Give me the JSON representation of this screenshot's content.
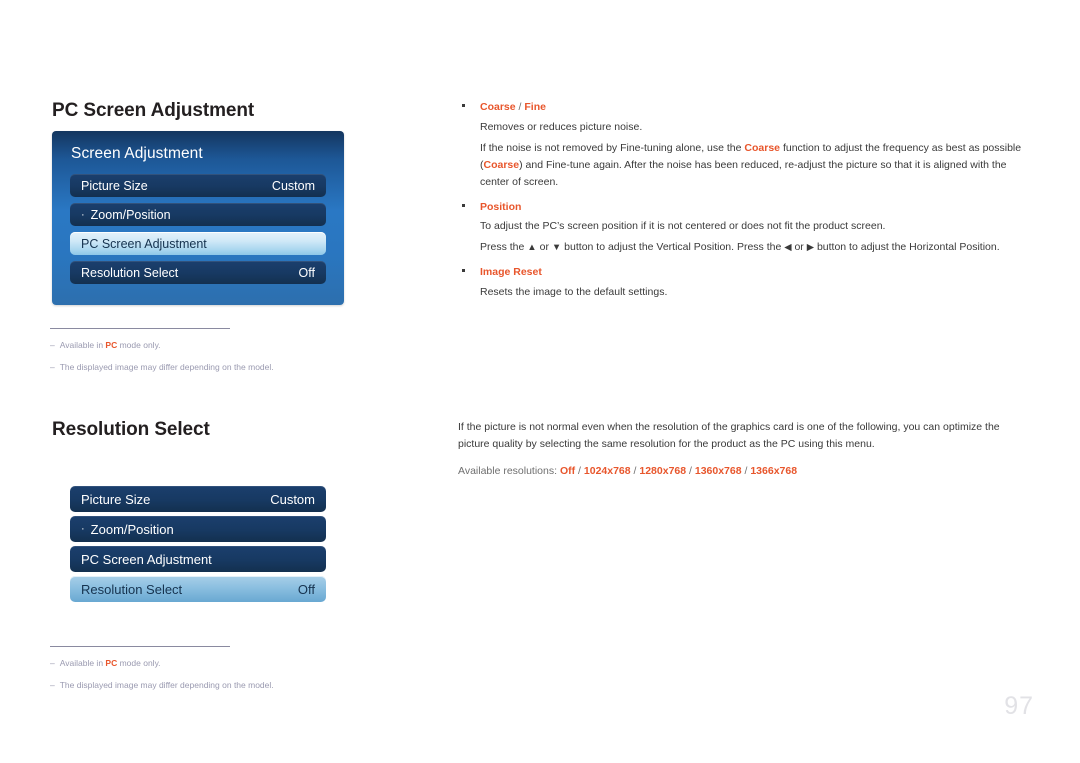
{
  "page": {
    "number": "97"
  },
  "sections": {
    "pc_screen_adjustment": {
      "heading": "PC Screen Adjustment",
      "menu": {
        "title": "Screen Adjustment",
        "rows": [
          {
            "label": "Picture Size",
            "value": "Custom",
            "state": "normal",
            "prefix": ""
          },
          {
            "label": "Zoom/Position",
            "value": "",
            "state": "normal",
            "prefix": "·"
          },
          {
            "label": "PC Screen Adjustment",
            "value": "",
            "state": "selected-light",
            "prefix": ""
          },
          {
            "label": "Resolution Select",
            "value": "Off",
            "state": "normal",
            "prefix": ""
          }
        ]
      },
      "footnotes": [
        {
          "dash": "–",
          "pre": "Available in ",
          "hl": "PC",
          "post": " mode only."
        },
        {
          "dash": "–",
          "pre": "The displayed image may differ depending on the model.",
          "hl": "",
          "post": ""
        }
      ],
      "items": [
        {
          "title_hl_1": "Coarse",
          "title_sep": " / ",
          "title_hl_2": "Fine",
          "lines": [
            "Removes or reduces picture noise."
          ],
          "rich_line_a_pre": "If the noise is not removed by Fine-tuning alone, use the ",
          "rich_line_a_hl": "Coarse",
          "rich_line_a_post": " function to adjust the frequency as best as possible",
          "rich_line_b_pre": "(",
          "rich_line_b_hl": "Coarse",
          "rich_line_b_post": ") and Fine-tune again. After the noise has been reduced, re-adjust the picture so that it is aligned with the center of screen."
        },
        {
          "title": "Position",
          "line_1": "To adjust the PC’s screen position if it is not centered or does not fit the product screen.",
          "line_2_part_1": "Press the ",
          "line_2_arrow_up": "▲",
          "line_2_part_2": " or ",
          "line_2_arrow_down": "▼",
          "line_2_part_3": " button to adjust the Vertical Position. Press the ",
          "line_2_arrow_left": "◀",
          "line_2_part_4": " or ",
          "line_2_arrow_right": "▶",
          "line_2_part_5": " button to adjust the Horizontal Position."
        },
        {
          "title": "Image Reset",
          "line_1": "Resets the image to the default settings."
        }
      ]
    },
    "resolution_select": {
      "heading": "Resolution Select",
      "menu": {
        "rows": [
          {
            "label": "Picture Size",
            "value": "Custom",
            "state": "normal",
            "prefix": ""
          },
          {
            "label": "Zoom/Position",
            "value": "",
            "state": "normal",
            "prefix": "·"
          },
          {
            "label": "PC Screen Adjustment",
            "value": "",
            "state": "normal",
            "prefix": ""
          },
          {
            "label": "Resolution Select",
            "value": "Off",
            "state": "selected-blue",
            "prefix": ""
          }
        ]
      },
      "footnotes": [
        {
          "dash": "–",
          "pre": "Available in ",
          "hl": "PC",
          "post": " mode only."
        },
        {
          "dash": "–",
          "pre": "The displayed image may differ depending on the model.",
          "hl": "",
          "post": ""
        }
      ],
      "description": "If the picture is not normal even when the resolution of the graphics card is one of the following, you can optimize the picture quality by selecting the same resolution for the product as the PC using this menu.",
      "available_label": "Available resolutions: ",
      "available_resolutions": [
        "Off",
        "1024x768",
        "1280x768",
        "1360x768",
        "1366x768"
      ],
      "resolution_separator": " / "
    }
  },
  "colors": {
    "accent_orange": "#e8562c",
    "heading_dark": "#231f20",
    "body_gray": "#3a3a3a",
    "footnote_gray": "#9a9ab0",
    "osd_panel_blue": "#2a78c4",
    "osd_row_navy": "#173962",
    "osd_selected_light": "#cfe8f7",
    "osd_selected_blue": "#8bbfe0",
    "page_number_gray": "#e2e2e6"
  }
}
